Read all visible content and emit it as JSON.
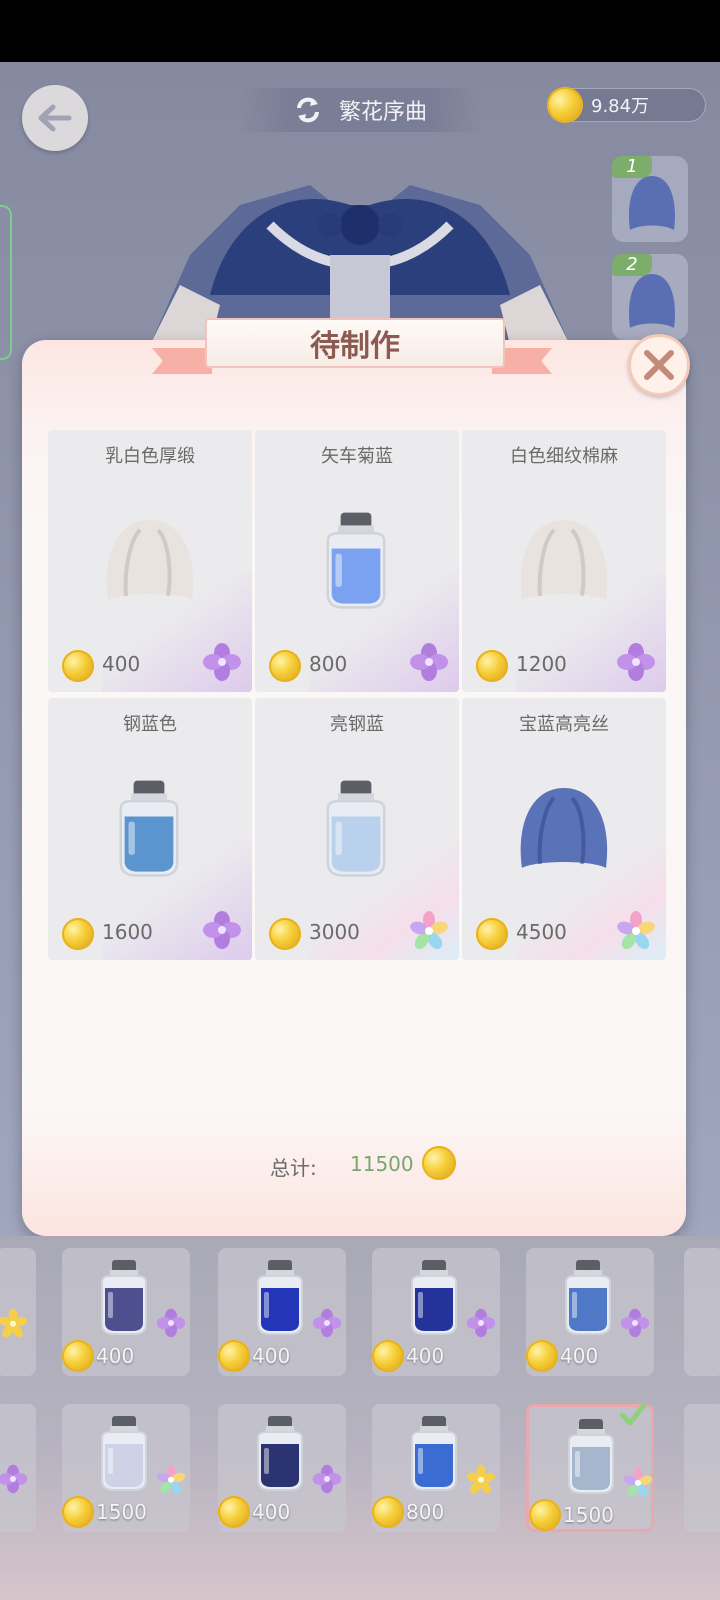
{
  "header": {
    "title": "繁花序曲",
    "currency": "9.84万"
  },
  "side_slots": [
    {
      "badge": "1"
    },
    {
      "badge": "2"
    }
  ],
  "modal": {
    "title": "待制作",
    "total_label": "总计:",
    "total_value": "11500"
  },
  "materials": [
    {
      "name": "乳白色厚缎",
      "price": "400",
      "icon": "fabric-white-icon",
      "rarity": "purple"
    },
    {
      "name": "矢车菊蓝",
      "price": "800",
      "icon": "dye-bottle-icon",
      "color": "#7aa2f0",
      "rarity": "purple"
    },
    {
      "name": "白色细纹棉麻",
      "price": "1200",
      "icon": "fabric-white-icon",
      "rarity": "purple"
    },
    {
      "name": "钢蓝色",
      "price": "1600",
      "icon": "dye-bottle-icon",
      "color": "#5b95cf",
      "rarity": "purple"
    },
    {
      "name": "亮钢蓝",
      "price": "3000",
      "icon": "dye-bottle-icon",
      "color": "#b9d1ec",
      "rarity": "rainbow"
    },
    {
      "name": "宝蓝高亮丝",
      "price": "4500",
      "icon": "fabric-blue-icon",
      "rarity": "rainbow"
    }
  ],
  "tray": {
    "row1": [
      {
        "price": "400",
        "color": "#4d4f8f"
      },
      {
        "price": "400",
        "color": "#2436b8"
      },
      {
        "price": "400",
        "color": "#23339a"
      },
      {
        "price": "400",
        "color": "#4f79c6"
      }
    ],
    "row2": [
      {
        "price": "1500",
        "color": "#cdd2e6"
      },
      {
        "price": "400",
        "color": "#2c3373"
      },
      {
        "price": "800",
        "color": "#3b6cd2"
      },
      {
        "price": "1500",
        "color": "#a6b6cd",
        "selected": true
      }
    ]
  },
  "colors": {
    "accent_green": "#7aa66c",
    "title_brown": "#8d5a52",
    "banner_pink": "#f7b0a6"
  }
}
